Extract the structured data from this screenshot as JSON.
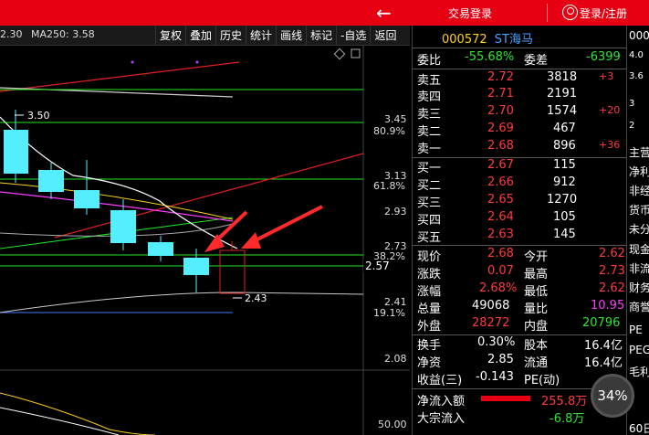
{
  "topbar": {
    "login_title": "交易登录",
    "login_register": "登录/注册"
  },
  "toolbar": {
    "ma_prefix": "2.30",
    "ma_label": "MA250: 3.58",
    "buttons": [
      "复权",
      "叠加",
      "历史",
      "统计",
      "画线",
      "标记",
      "-自选",
      "返回"
    ]
  },
  "chart": {
    "y_labels": [
      "3.45",
      "80.9%",
      "3.13",
      "61.8%",
      "2.93",
      "2.73",
      "38.2%",
      "2.57",
      "2.41",
      "19.1%",
      "2.08",
      "50.00"
    ],
    "annot_high": "3.50",
    "annot_low": "2.43"
  },
  "quote": {
    "code": "000572",
    "name": "ST海马",
    "ratio": {
      "label1": "委比",
      "val1": "-55.68%",
      "label2": "委差",
      "val2": "-6399"
    },
    "asks": [
      {
        "label": "卖五",
        "price": "2.72",
        "vol": "3818",
        "chg": "+3"
      },
      {
        "label": "卖四",
        "price": "2.71",
        "vol": "2191",
        "chg": ""
      },
      {
        "label": "卖三",
        "price": "2.70",
        "vol": "1574",
        "chg": "+20"
      },
      {
        "label": "卖二",
        "price": "2.69",
        "vol": "467",
        "chg": ""
      },
      {
        "label": "卖一",
        "price": "2.68",
        "vol": "896",
        "chg": "+36"
      }
    ],
    "bids": [
      {
        "label": "买一",
        "price": "2.67",
        "vol": "115"
      },
      {
        "label": "买二",
        "price": "2.66",
        "vol": "912"
      },
      {
        "label": "买三",
        "price": "2.65",
        "vol": "1270"
      },
      {
        "label": "买四",
        "price": "2.64",
        "vol": "105"
      },
      {
        "label": "买五",
        "price": "2.63",
        "vol": "145"
      }
    ],
    "stats": [
      {
        "l1": "现价",
        "v1": "2.68",
        "c1": "red",
        "l2": "今开",
        "v2": "2.62",
        "c2": "red"
      },
      {
        "l1": "涨跌",
        "v1": "0.07",
        "c1": "red",
        "l2": "最高",
        "v2": "2.73",
        "c2": "red"
      },
      {
        "l1": "涨幅",
        "v1": "2.68%",
        "c1": "red",
        "l2": "最低",
        "v2": "2.62",
        "c2": "red"
      },
      {
        "l1": "总量",
        "v1": "49068",
        "c1": "white",
        "l2": "量比",
        "v2": "10.95",
        "c2": "purple"
      },
      {
        "l1": "外盘",
        "v1": "28272",
        "c1": "red",
        "l2": "内盘",
        "v2": "20796",
        "c2": "green"
      }
    ],
    "stats2": [
      {
        "l1": "换手",
        "v1": "0.30%",
        "l2": "股本",
        "v2": "16.4亿"
      },
      {
        "l1": "净资",
        "v1": "2.85",
        "l2": "流通",
        "v2": "16.4亿"
      },
      {
        "l1": "收益(三)",
        "v1": "-0.143",
        "l2": "PE(动)",
        "v2": ""
      }
    ],
    "flow": [
      {
        "label": "净流入额",
        "value": "255.8万",
        "color": "red"
      },
      {
        "label": "大宗流入",
        "value": "-6.8万",
        "color": "green"
      }
    ]
  },
  "side": {
    "header": "000",
    "nums": [
      "4.0",
      "3.6",
      "3",
      "2"
    ],
    "items": [
      "主营",
      "净利",
      "非经",
      "货币",
      "未分",
      "现金",
      "非流",
      "财务",
      "商誉",
      "PE",
      "PEG",
      "毛利",
      "60日"
    ]
  },
  "progress": {
    "label": "34%",
    "value": 34
  }
}
